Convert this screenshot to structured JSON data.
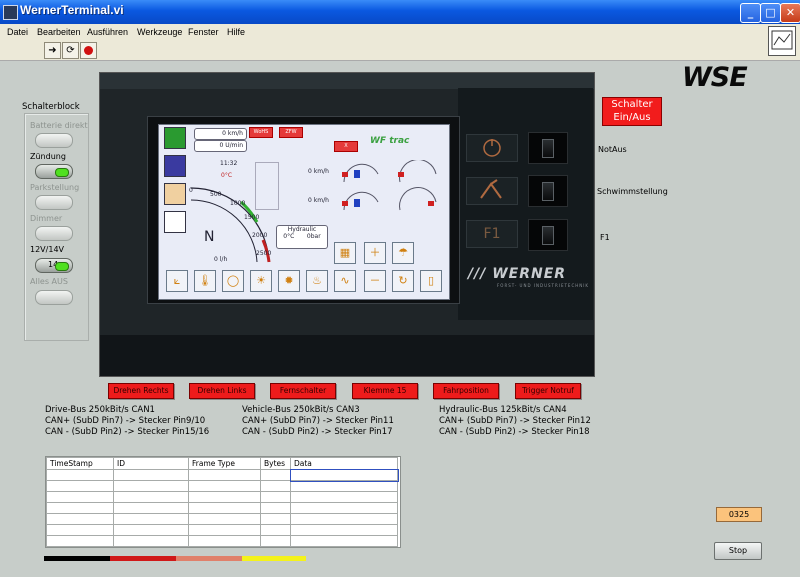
{
  "window": {
    "title": "WernerTerminal.vi",
    "min": "_",
    "max": "□",
    "close": "✕"
  },
  "menu": [
    "Datei",
    "Bearbeiten",
    "Ausführen",
    "Werkzeuge",
    "Fenster",
    "Hilfe"
  ],
  "toolbar": {
    "run_icon": "run-arrow-icon",
    "run_cont_icon": "run-continuous-icon",
    "abort_icon": "abort-stop-icon"
  },
  "logo": "WSE",
  "switch_block": {
    "title": "Schalterblock",
    "items": [
      {
        "label": "Batterie direkt",
        "enabled": false,
        "button_text": ""
      },
      {
        "label": "Zündung",
        "enabled": true,
        "button_text": ""
      },
      {
        "label": "Parkstellung",
        "enabled": false,
        "button_text": ""
      },
      {
        "label": "Dimmer",
        "enabled": false,
        "button_text": ""
      },
      {
        "label": "12V/14V",
        "enabled": true,
        "button_text": "14"
      },
      {
        "label": "Alles AUS",
        "enabled": false,
        "button_text": ""
      }
    ]
  },
  "main_switch": {
    "label": "Schalter Ein/Aus"
  },
  "side_switches": [
    {
      "label": "NotAus",
      "key_label": ""
    },
    {
      "label": "Schwimmstellung",
      "key_label": ""
    },
    {
      "label": "F1",
      "key_label": "F1"
    }
  ],
  "device_brand": {
    "name": "WERNER",
    "tagline": "FORST- UND INDUSTRIETECHNIK"
  },
  "screen": {
    "speed_kmh": "0",
    "speed_kmh_unit": "km/h",
    "rpm": "0",
    "rpm_unit": "U/min",
    "time": "11:32",
    "temp": "0°C",
    "gear": "N",
    "tag1": "WoHS",
    "tag2": "ZFW",
    "tag3": "X",
    "brand": "WF trac",
    "right_speed_1": "0",
    "right_speed_1_unit": "km/h",
    "right_speed_2": "0",
    "right_speed_2_unit": "km/h",
    "hydraulic_label": "Hydraulic",
    "hydraulic_temp": "0°C",
    "hydraulic_pressure": "0bar",
    "bottom_value": "0",
    "bottom_unit": "l/h",
    "gauge_ticks": [
      "0",
      "500",
      "1000",
      "1500",
      "2000",
      "2500"
    ]
  },
  "control_buttons": [
    "Drehen Rechts",
    "Drehen Links",
    "Fernschalter",
    "Klemme 15",
    "Fahrposition",
    "Trigger Notruf"
  ],
  "buses": [
    {
      "line1": "Drive-Bus 250kBit/s  CAN1",
      "line2": "CAN+ (SubD Pin7) -> Stecker Pin9/10",
      "line3": "CAN - (SubD Pin2) -> Stecker Pin15/16"
    },
    {
      "line1": "Vehicle-Bus 250kBit/s  CAN3",
      "line2": "CAN+ (SubD Pin7) -> Stecker Pin11",
      "line3": "CAN - (SubD Pin2) -> Stecker Pin17"
    },
    {
      "line1": "Hydraulic-Bus 125kBit/s  CAN4",
      "line2": "CAN+ (SubD Pin7) -> Stecker Pin12",
      "line3": "CAN - (SubD Pin2) -> Stecker Pin18"
    }
  ],
  "table": {
    "columns": [
      "TimeStamp",
      "ID",
      "Frame Type",
      "Bytes",
      "Data"
    ],
    "rows": 7
  },
  "status_stripe_colors": [
    "#000000",
    "#d01818",
    "#e0806a",
    "#f4f21a"
  ],
  "readout": "0325",
  "stop_button": "Stop"
}
